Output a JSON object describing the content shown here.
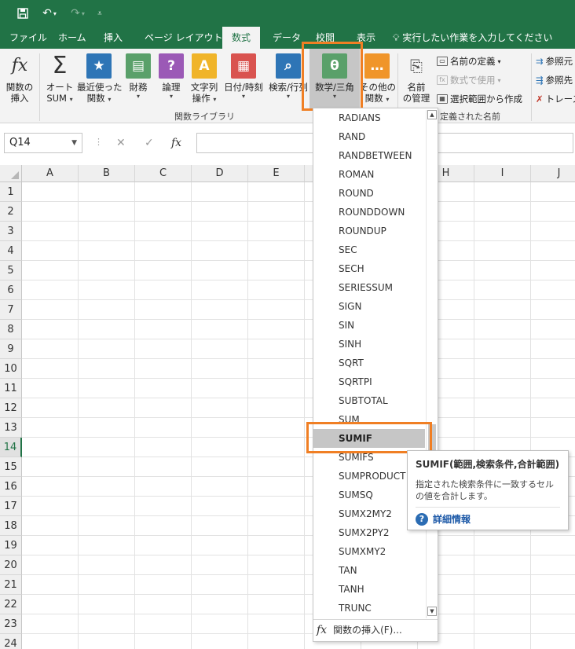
{
  "quick_access": {
    "save_icon": "save-icon",
    "undo_icon": "undo-icon",
    "redo_icon": "redo-icon",
    "customize_icon": "customize-icon"
  },
  "tabs": [
    {
      "label": "ファイル"
    },
    {
      "label": "ホーム"
    },
    {
      "label": "挿入"
    },
    {
      "label": "ページ レイアウト"
    },
    {
      "label": "数式"
    },
    {
      "label": "データ"
    },
    {
      "label": "校閲"
    },
    {
      "label": "表示"
    }
  ],
  "tell_me": "実行したい作業を入力してください",
  "ribbon": {
    "insert_function": [
      "関数の",
      "挿入"
    ],
    "autosum": [
      "オート",
      "SUM"
    ],
    "recent": [
      "最近使った",
      "関数"
    ],
    "financial": "財務",
    "logical": "論理",
    "text": [
      "文字列",
      "操作"
    ],
    "datetime": "日付/時刻",
    "lookup": "検索/行列",
    "math": "数学/三角",
    "more": [
      "その他の",
      "関数"
    ],
    "name_manager": [
      "名前",
      "の管理"
    ],
    "define_name": "名前の定義",
    "use_in_formula": "数式で使用",
    "create_from_selection": "選択範囲から作成",
    "function_library_label": "関数ライブラリ",
    "defined_names_label": "定義された名前",
    "trace_precedents": "参照元",
    "trace_dependents": "参照先",
    "remove_arrows": "トレース",
    "colors": {
      "accent": "#217346",
      "highlight": "#f07f24"
    }
  },
  "formula_bar": {
    "name_box": "Q14",
    "fx": "fx",
    "cancel": "✕",
    "enter": "✓"
  },
  "grid": {
    "columns": [
      "A",
      "B",
      "C",
      "D",
      "E",
      "F",
      "G",
      "H",
      "I",
      "J"
    ],
    "rows": [
      "1",
      "2",
      "3",
      "4",
      "5",
      "6",
      "7",
      "8",
      "9",
      "10",
      "11",
      "12",
      "13",
      "14",
      "15",
      "16",
      "17",
      "18",
      "19",
      "20",
      "21",
      "22",
      "23",
      "24"
    ],
    "selected_row": "14"
  },
  "menu": {
    "items": [
      "RADIANS",
      "RAND",
      "RANDBETWEEN",
      "ROMAN",
      "ROUND",
      "ROUNDDOWN",
      "ROUNDUP",
      "SEC",
      "SECH",
      "SERIESSUM",
      "SIGN",
      "SIN",
      "SINH",
      "SQRT",
      "SQRTPI",
      "SUBTOTAL",
      "SUM",
      "SUMIF",
      "SUMIFS",
      "SUMPRODUCT",
      "SUMSQ",
      "SUMX2MY2",
      "SUMX2PY2",
      "SUMXMY2",
      "TAN",
      "TANH",
      "TRUNC"
    ],
    "selected": "SUMIF",
    "insert_function": "関数の挿入(F)..."
  },
  "tooltip": {
    "title": "SUMIF(範囲,検索条件,合計範囲)",
    "description": "指定された検索条件に一致するセルの値を合計します。",
    "more": "詳細情報"
  }
}
